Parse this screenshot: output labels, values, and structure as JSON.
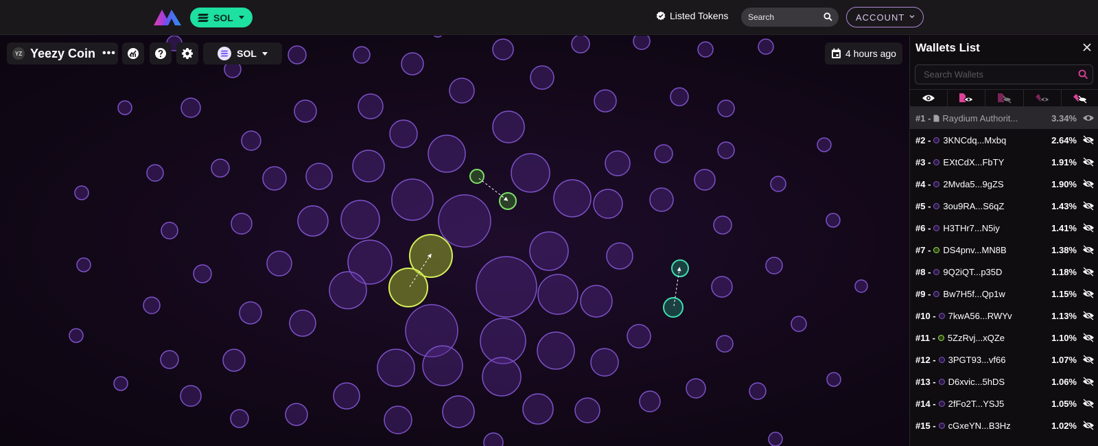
{
  "topbar": {
    "chain_label": "SOL",
    "listed_tokens": "Listed Tokens",
    "search_placeholder": "Search",
    "account_label": "ACCOUNT"
  },
  "map_toolbar": {
    "token_avatar": "YZ",
    "token_name": "Yeezy Coin",
    "more_label": "•••",
    "network_label": "SOL",
    "time_label": "4 hours ago"
  },
  "sidebar": {
    "title": "Wallets List",
    "search_placeholder": "Search Wallets",
    "filter_icons": [
      "eye-icon",
      "doc-eye-icon",
      "doc-eye-off-icon",
      "link-eye-icon",
      "link-eye-off-icon"
    ],
    "wallets": [
      {
        "rank": "#1 -",
        "address": "Raydium Authorit...",
        "percent": "3.34%",
        "kind": "contract",
        "visible": true
      },
      {
        "rank": "#2 -",
        "address": "3KNCdq...Mxbq",
        "percent": "2.64%",
        "kind": "purple",
        "visible": false
      },
      {
        "rank": "#3 -",
        "address": "EXtCdX...FbTY",
        "percent": "1.91%",
        "kind": "purple",
        "visible": false
      },
      {
        "rank": "#4 -",
        "address": "2Mvda5...9gZS",
        "percent": "1.90%",
        "kind": "purple",
        "visible": false
      },
      {
        "rank": "#5 -",
        "address": "3ou9RA...S6qZ",
        "percent": "1.43%",
        "kind": "purple",
        "visible": false
      },
      {
        "rank": "#6 -",
        "address": "H3THr7...N5iy",
        "percent": "1.41%",
        "kind": "purple",
        "visible": false
      },
      {
        "rank": "#7 -",
        "address": "DS4pnv...MN8B",
        "percent": "1.38%",
        "kind": "green",
        "visible": false
      },
      {
        "rank": "#8 -",
        "address": "9Q2iQT...p35D",
        "percent": "1.18%",
        "kind": "purple",
        "visible": false
      },
      {
        "rank": "#9 -",
        "address": "Bw7H5f...Qp1w",
        "percent": "1.15%",
        "kind": "purple",
        "visible": false
      },
      {
        "rank": "#10 -",
        "address": "7kwA56...RWYv",
        "percent": "1.13%",
        "kind": "purple",
        "visible": false
      },
      {
        "rank": "#11 -",
        "address": "5ZzRvj...xQZe",
        "percent": "1.10%",
        "kind": "green",
        "visible": false
      },
      {
        "rank": "#12 -",
        "address": "3PGT93...vf66",
        "percent": "1.07%",
        "kind": "purple",
        "visible": false
      },
      {
        "rank": "#13 -",
        "address": "D6xvic...5hDS",
        "percent": "1.06%",
        "kind": "purple",
        "visible": false
      },
      {
        "rank": "#14 -",
        "address": "2fFo2T...YSJ5",
        "percent": "1.05%",
        "kind": "purple",
        "visible": false
      },
      {
        "rank": "#15 -",
        "address": "cGxeYN...B3Hz",
        "percent": "1.02%",
        "kind": "purple",
        "visible": false
      }
    ]
  },
  "colors": {
    "accent_green": "#1ee0a0",
    "bubble_purple": "#7a4fc4",
    "bubble_fill": "#3a1f5e",
    "cluster_yellow": "#d6f05a",
    "cluster_green": "#7ee06a",
    "cluster_teal": "#3fe0b0",
    "search_pink": "#e0409a"
  }
}
